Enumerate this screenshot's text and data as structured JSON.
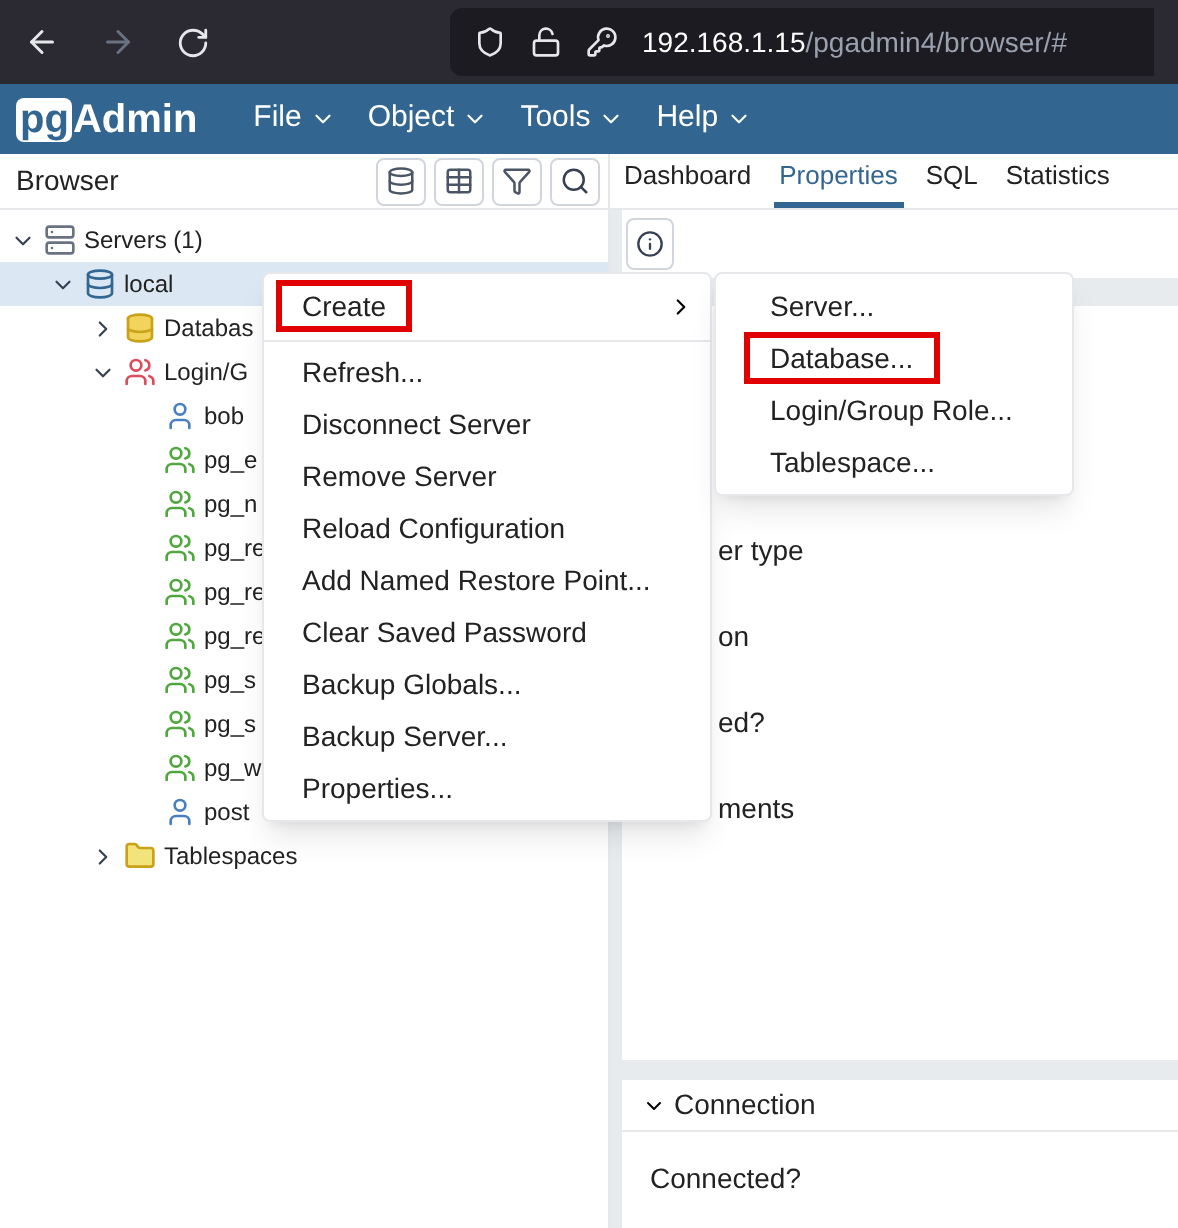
{
  "browser": {
    "url_host": "192.168.1.15",
    "url_path": "/pgadmin4/browser/#",
    "forward_disabled": true
  },
  "app": {
    "logo_pg": "pg",
    "logo_rest": "Admin",
    "menus": [
      "File",
      "Object",
      "Tools",
      "Help"
    ]
  },
  "browser_panel": {
    "title": "Browser"
  },
  "tabs": [
    {
      "label": "Dashboard",
      "selected": false
    },
    {
      "label": "Properties",
      "selected": true
    },
    {
      "label": "SQL",
      "selected": false
    },
    {
      "label": "Statistics",
      "selected": false
    }
  ],
  "tree": [
    {
      "label": "Servers (1)",
      "kind": "servers",
      "expanded": true,
      "selected": false,
      "children": [
        {
          "label": "local",
          "kind": "server",
          "expanded": true,
          "selected": true,
          "children": [
            {
              "label": "Databas",
              "kind": "databases",
              "expanded": false,
              "selected": false
            },
            {
              "label": "Login/G",
              "kind": "roles",
              "expanded": true,
              "selected": false,
              "children": [
                {
                  "label": "bob",
                  "kind": "user",
                  "selected": false
                },
                {
                  "label": "pg_e",
                  "kind": "group",
                  "selected": false
                },
                {
                  "label": "pg_n",
                  "kind": "group",
                  "selected": false
                },
                {
                  "label": "pg_re",
                  "kind": "group",
                  "selected": false
                },
                {
                  "label": "pg_re",
                  "kind": "group",
                  "selected": false
                },
                {
                  "label": "pg_re",
                  "kind": "group",
                  "selected": false
                },
                {
                  "label": "pg_s",
                  "kind": "group",
                  "selected": false
                },
                {
                  "label": "pg_s",
                  "kind": "group",
                  "selected": false
                },
                {
                  "label": "pg_w",
                  "kind": "group",
                  "selected": false
                },
                {
                  "label": "post",
                  "kind": "user",
                  "selected": false
                }
              ]
            },
            {
              "label": "Tablespaces",
              "kind": "tablespaces",
              "expanded": false,
              "selected": false
            }
          ]
        }
      ]
    }
  ],
  "context_menu": [
    {
      "label": "Create",
      "submenu": true,
      "highlighted": true
    },
    {
      "label": "Refresh...",
      "submenu": false,
      "highlighted": false
    },
    {
      "label": "Disconnect Server",
      "submenu": false,
      "highlighted": false
    },
    {
      "label": "Remove Server",
      "submenu": false,
      "highlighted": false
    },
    {
      "label": "Reload Configuration",
      "submenu": false,
      "highlighted": false
    },
    {
      "label": "Add Named Restore Point...",
      "submenu": false,
      "highlighted": false
    },
    {
      "label": "Clear Saved Password",
      "submenu": false,
      "highlighted": false
    },
    {
      "label": "Backup Globals...",
      "submenu": false,
      "highlighted": false
    },
    {
      "label": "Backup Server...",
      "submenu": false,
      "highlighted": false
    },
    {
      "label": "Properties...",
      "submenu": false,
      "highlighted": false
    }
  ],
  "submenu": [
    {
      "label": "Server...",
      "highlighted": false
    },
    {
      "label": "Database...",
      "highlighted": true
    },
    {
      "label": "Login/Group Role...",
      "highlighted": false
    },
    {
      "label": "Tablespace...",
      "highlighted": false
    }
  ],
  "properties": {
    "labels": [
      "er type",
      "on",
      "ed?",
      "ments"
    ],
    "section": {
      "title": "Connection",
      "expanded": true,
      "rows": [
        "Connected?"
      ]
    }
  }
}
